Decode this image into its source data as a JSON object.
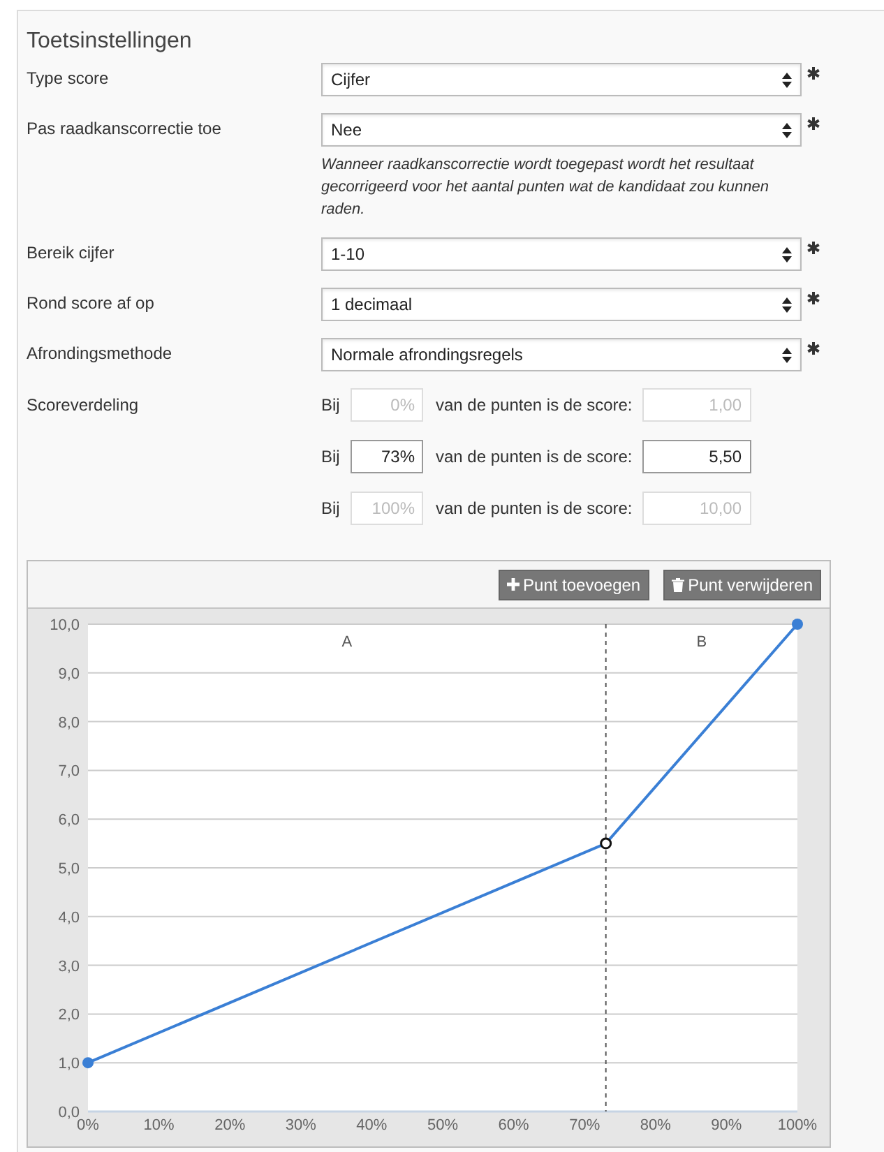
{
  "section": {
    "title": "Toetsinstellingen"
  },
  "fields": [
    {
      "label": "Type score",
      "value": "Cijfer",
      "required": true
    },
    {
      "label": "Pas raadkanscorrectie toe",
      "value": "Nee",
      "required": true,
      "help": "Wanneer raadkanscorrectie wordt toegepast wordt het resultaat gecorrigeerd voor het aantal punten wat de kandidaat zou kunnen raden."
    },
    {
      "label": "Bereik cijfer",
      "value": "1-10",
      "required": true
    },
    {
      "label": "Rond score af op",
      "value": "1 decimaal",
      "required": true
    },
    {
      "label": "Afrondingsmethode",
      "value": "Normale afrondingsregels",
      "required": true
    }
  ],
  "distribution": {
    "label": "Scoreverdeling",
    "rows": [
      {
        "prefix": "Bij",
        "percent": "0%",
        "middle": "van de punten is de score:",
        "score": "1,00",
        "disabled": true
      },
      {
        "prefix": "Bij",
        "percent": "73%",
        "middle": "van de punten is de score:",
        "score": "5,50",
        "disabled": false
      },
      {
        "prefix": "Bij",
        "percent": "100%",
        "middle": "van de punten is de score:",
        "score": "10,00",
        "disabled": true
      }
    ]
  },
  "toolbar": {
    "buttons": [
      {
        "label": "Punt toevoegen",
        "kind": "add"
      },
      {
        "label": "Punt verwijderen",
        "kind": "delete"
      }
    ]
  },
  "chart_data": {
    "type": "line",
    "x": [
      0,
      73,
      100
    ],
    "series": [
      {
        "color": "#3a7fd5",
        "marker": "circle",
        "values": [
          1,
          5.5,
          10
        ]
      }
    ],
    "grid": true,
    "xlim": [
      0,
      100
    ],
    "ylim": [
      0,
      10
    ],
    "xticks": [
      {
        "value": 0,
        "label": "0%"
      },
      {
        "value": 10,
        "label": "10%"
      },
      {
        "value": 20,
        "label": "20%"
      },
      {
        "value": 30,
        "label": "30%"
      },
      {
        "value": 40,
        "label": "40%"
      },
      {
        "value": 50,
        "label": "50%"
      },
      {
        "value": 60,
        "label": "60%"
      },
      {
        "value": 70,
        "label": "70%"
      },
      {
        "value": 80,
        "label": "80%"
      },
      {
        "value": 90,
        "label": "90%"
      },
      {
        "value": 100,
        "label": "100%"
      }
    ],
    "yticks": [
      {
        "value": 0,
        "label": "0,0"
      },
      {
        "value": 1,
        "label": "1,0"
      },
      {
        "value": 2,
        "label": "2,0"
      },
      {
        "value": 3,
        "label": "3,0"
      },
      {
        "value": 4,
        "label": "4,0"
      },
      {
        "value": 5,
        "label": "5,0"
      },
      {
        "value": 6,
        "label": "6,0"
      },
      {
        "value": 7,
        "label": "7,0"
      },
      {
        "value": 8,
        "label": "8,0"
      },
      {
        "value": 9,
        "label": "9,0"
      },
      {
        "value": 10,
        "label": "10,0"
      }
    ],
    "annotations": [
      "A",
      "B"
    ],
    "ref_lines": [
      {
        "axis": "x",
        "value": 73
      }
    ]
  }
}
